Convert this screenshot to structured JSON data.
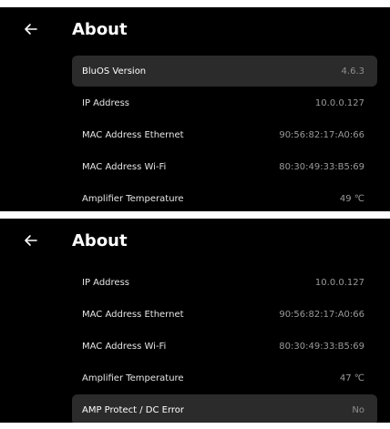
{
  "screens": [
    {
      "title": "About",
      "rows": [
        {
          "label": "BluOS Version",
          "value": "4.6.3",
          "selected": true
        },
        {
          "label": "IP Address",
          "value": "10.0.0.127",
          "selected": false
        },
        {
          "label": "MAC Address Ethernet",
          "value": "90:56:82:17:A0:66",
          "selected": false
        },
        {
          "label": "MAC Address Wi-Fi",
          "value": "80:30:49:33:B5:69",
          "selected": false
        },
        {
          "label": "Amplifier Temperature",
          "value": "49 ℃",
          "selected": false
        }
      ]
    },
    {
      "title": "About",
      "rows": [
        {
          "label": "IP Address",
          "value": "10.0.0.127",
          "selected": false
        },
        {
          "label": "MAC Address Ethernet",
          "value": "90:56:82:17:A0:66",
          "selected": false
        },
        {
          "label": "MAC Address Wi-Fi",
          "value": "80:30:49:33:B5:69",
          "selected": false
        },
        {
          "label": "Amplifier Temperature",
          "value": "47 ℃",
          "selected": false
        },
        {
          "label": "AMP Protect / DC Error",
          "value": "No",
          "selected": true
        }
      ]
    }
  ],
  "icons": {
    "back": "arrow-left-icon"
  },
  "colors": {
    "background": "#000000",
    "selected_row": "#2b2b2b",
    "text": "#ffffff",
    "value_text": "#9a9a9a"
  }
}
